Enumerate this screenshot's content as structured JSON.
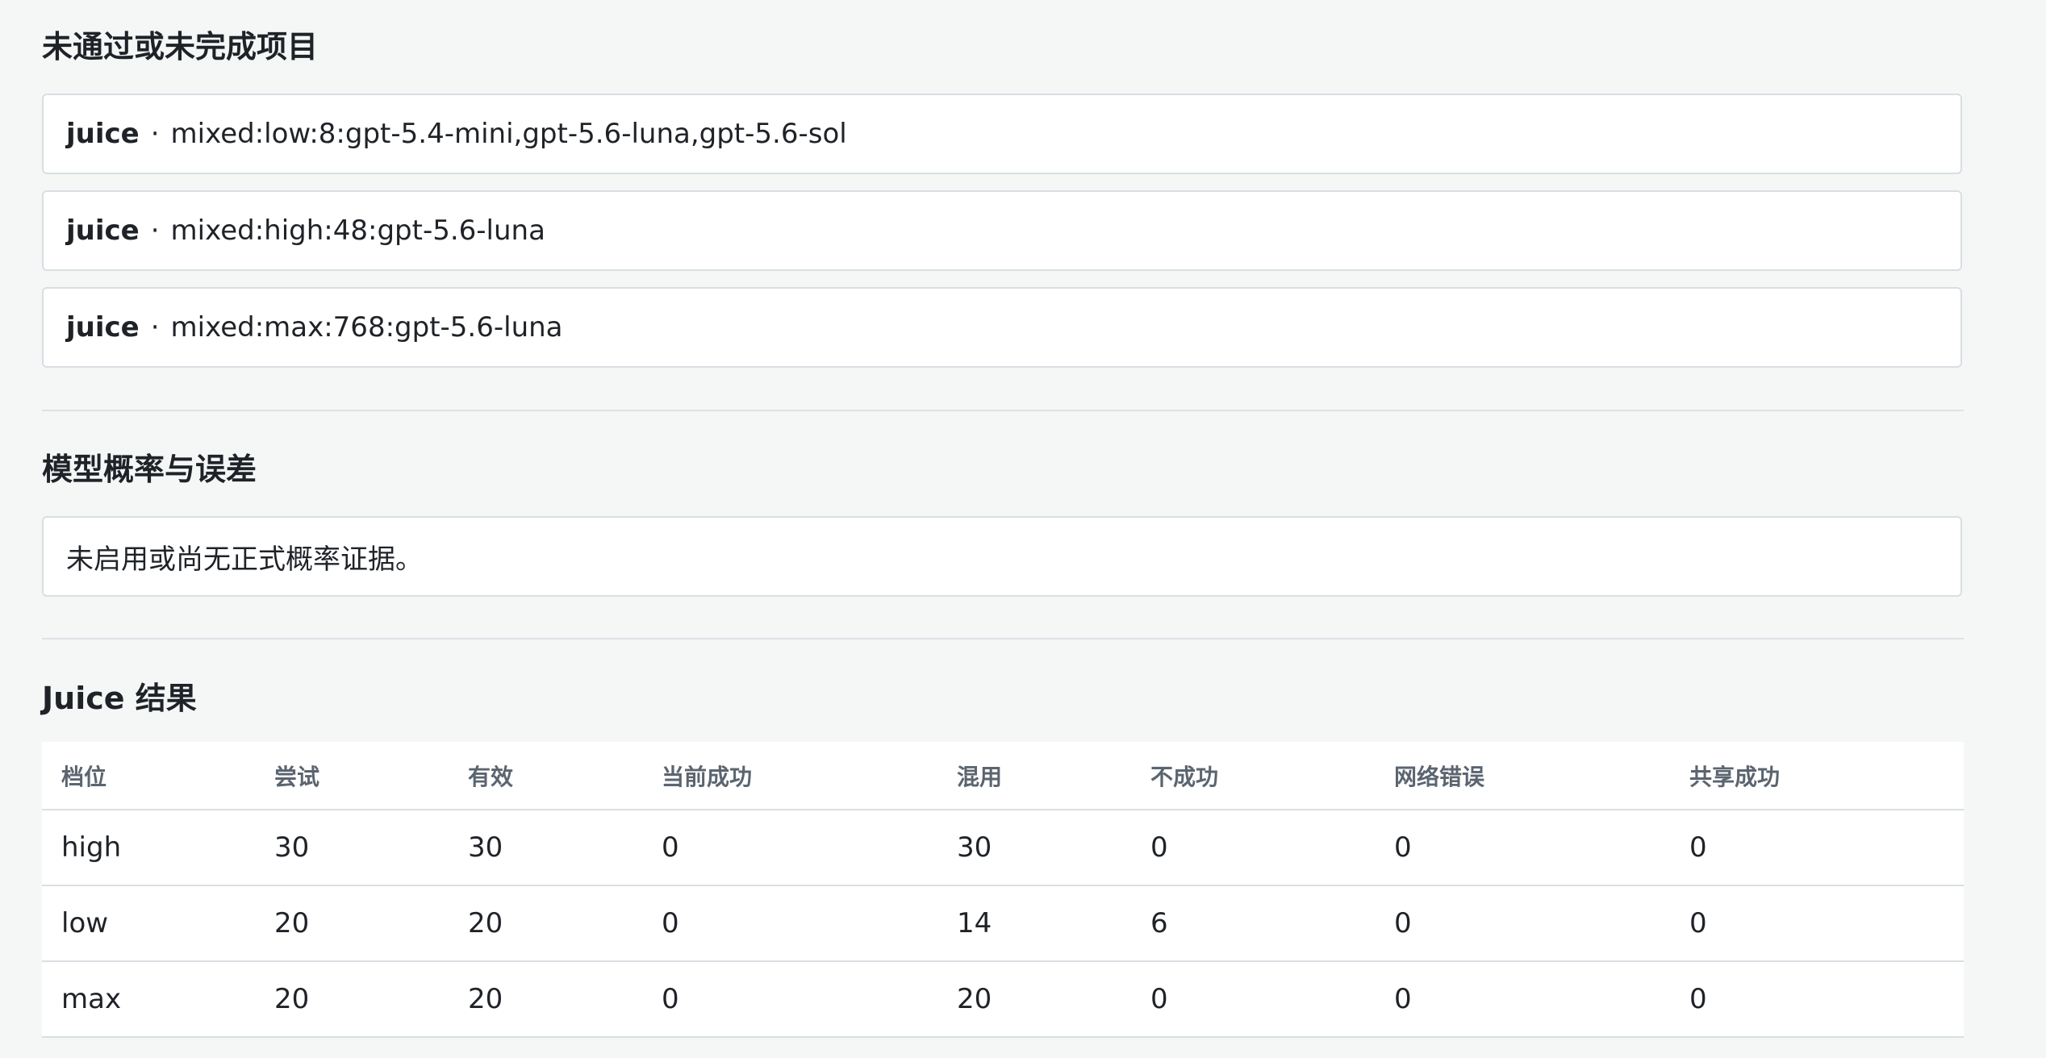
{
  "failed_section": {
    "title": "未通过或未完成项目",
    "items": [
      {
        "name": "juice",
        "separator": "·",
        "detail": "mixed:low:8:gpt-5.4-mini,gpt-5.6-luna,gpt-5.6-sol"
      },
      {
        "name": "juice",
        "separator": "·",
        "detail": "mixed:high:48:gpt-5.6-luna"
      },
      {
        "name": "juice",
        "separator": "·",
        "detail": "mixed:max:768:gpt-5.6-luna"
      }
    ]
  },
  "probability_section": {
    "title": "模型概率与误差",
    "message": "未启用或尚无正式概率证据。"
  },
  "juice_section": {
    "title": "Juice 结果",
    "columns": [
      "档位",
      "尝试",
      "有效",
      "当前成功",
      "混用",
      "不成功",
      "网络错误",
      "共享成功"
    ],
    "rows": [
      [
        "high",
        "30",
        "30",
        "0",
        "30",
        "0",
        "0",
        "0"
      ],
      [
        "low",
        "20",
        "20",
        "0",
        "14",
        "6",
        "0",
        "0"
      ],
      [
        "max",
        "20",
        "20",
        "0",
        "20",
        "0",
        "0",
        "0"
      ]
    ]
  }
}
